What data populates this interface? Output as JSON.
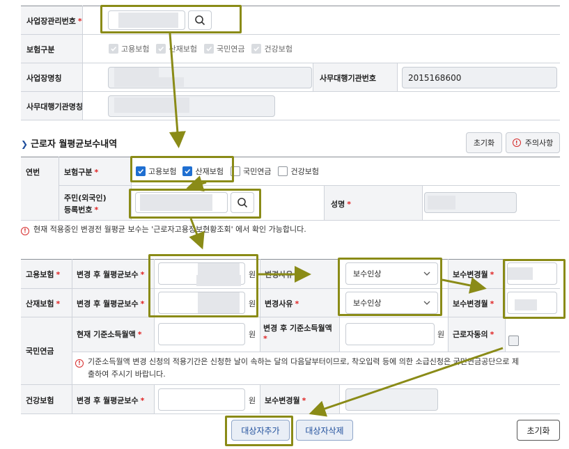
{
  "top_form": {
    "biz_no_label": "사업장관리번호",
    "insurance_type_label": "보험구분",
    "insurance_options": [
      "고용보험",
      "산재보험",
      "국민연금",
      "건강보험"
    ],
    "biz_name_label": "사업장명칭",
    "agency_no_label": "사무대행기관번호",
    "agency_no_value": "2015168600",
    "agency_name_label": "사무대행기관명칭"
  },
  "section": {
    "title": "근로자 월평균보수내역",
    "reset_label": "초기화",
    "caution_label": "주의사항"
  },
  "worker_form": {
    "year_label": "연번",
    "insurance_type_label": "보험구분",
    "insurance_options": [
      "고용보험",
      "산재보험",
      "국민연금",
      "건강보험"
    ],
    "checked": [
      true,
      true,
      false,
      false
    ],
    "resident_no_label_1": "주민(외국인)",
    "resident_no_label_2": "등록번호",
    "name_label": "성명"
  },
  "notice": "현재 적용중인 변경전 월평균 보수는 '근로자고용정보현황조회' 에서 확인 가능합니다.",
  "detail": {
    "employment_label": "고용보험",
    "industrial_label": "산재보험",
    "pension_label": "국민연금",
    "health_label": "건강보험",
    "changed_avg_pay_label": "변경 후 월평균보수",
    "won": "원",
    "change_reason_label": "변경사유",
    "change_reason_partial": "변경사유",
    "reason_value_1": "보수인상",
    "reason_value_2": "보수인상",
    "pay_change_month_label": "보수변경월",
    "current_base_income_label": "현재 기준소득월액",
    "changed_base_income_label_1": "변경 후 기준소득월액",
    "worker_consent_label": "근로자동의",
    "pension_notice_1": "기준소득월액 변경 신청의 적용기간은 신청한 날이 속하는 달의 다음달부터이므로, 착오입력 등에 의한 소급신청은 국민연금공단으로 제",
    "pension_notice_2": "출하여 주시기 바랍니다."
  },
  "actions": {
    "add_label": "대상자추가",
    "delete_label": "대상자삭제",
    "reset_label": "초기화"
  },
  "colors": {
    "highlight": "#8a8b17",
    "required": "#e02424",
    "checkbox_on": "#1f6fd1",
    "action_blue": "#1f4e9c"
  }
}
